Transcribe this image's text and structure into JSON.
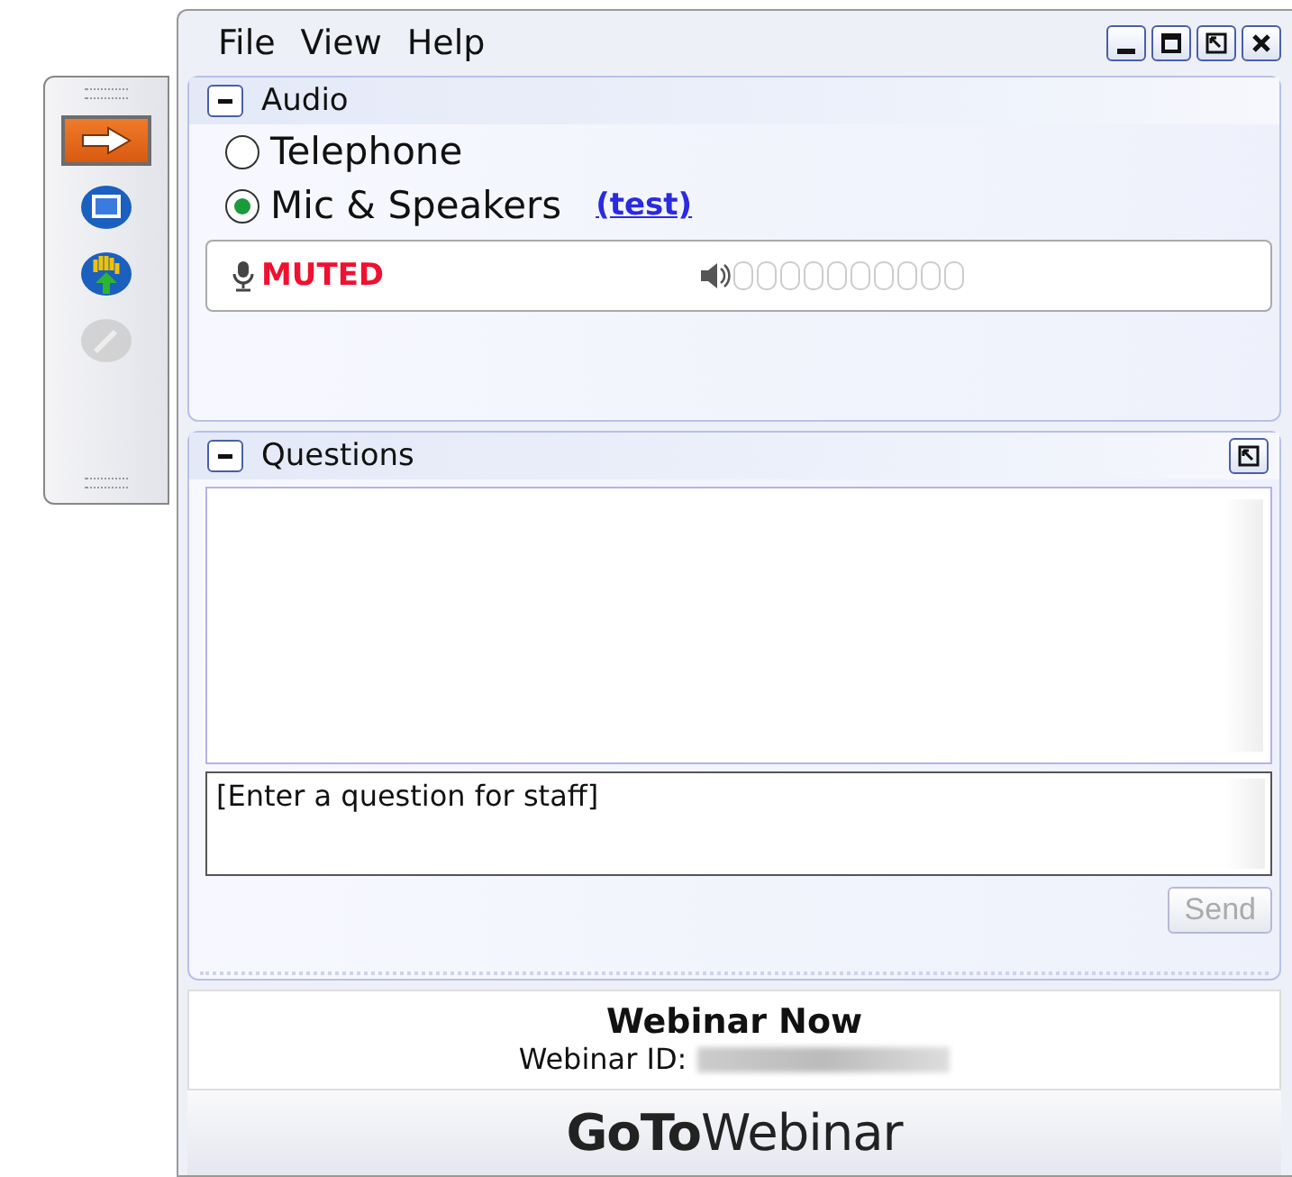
{
  "toolbar": [
    {
      "kind": "arrow",
      "selected": true,
      "disabled": false
    },
    {
      "kind": "screen",
      "selected": false,
      "disabled": false
    },
    {
      "kind": "hand",
      "selected": false,
      "disabled": false
    },
    {
      "kind": "pencil",
      "selected": false,
      "disabled": true
    }
  ],
  "menu": [
    "File",
    "View",
    "Help"
  ],
  "audio": {
    "title": "Audio",
    "expanded": true,
    "options": [
      {
        "label": "Telephone",
        "selected": false
      },
      {
        "label": "Mic & Speakers",
        "selected": true
      }
    ],
    "test_link": "(test)",
    "mic_status": "MUTED",
    "muted": true,
    "volume": {
      "level": 0
    }
  },
  "questions": {
    "title": "Questions",
    "expanded": true,
    "placeholder": "[Enter a question for staff]",
    "send": {
      "label": "Send",
      "disabled": true
    }
  },
  "info": {
    "title": "Webinar Now",
    "id_label": "Webinar ID:"
  },
  "logo": "**GoTo**Webinar"
}
